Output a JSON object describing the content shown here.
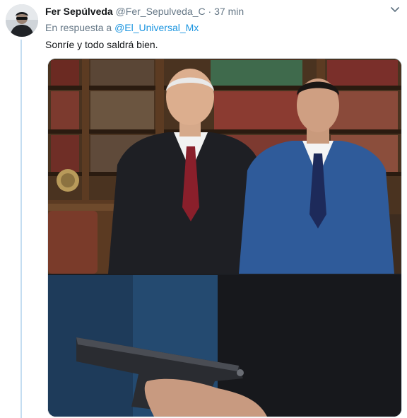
{
  "tweet": {
    "display_name": "Fer Sepúlveda",
    "handle": "@Fer_Sepulveda_C",
    "separator": "·",
    "time": "37 min",
    "reply_prefix": "En respuesta a",
    "reply_to": "@El_Universal_Mx",
    "text": "Sonríe y todo saldrá bien."
  },
  "icons": {
    "menu": "chevron-down-icon",
    "seal": "coat-of-arms-icon"
  },
  "colors": {
    "link": "#1b95e0",
    "meta": "#657786",
    "thread_line": "#c4ddf1"
  }
}
